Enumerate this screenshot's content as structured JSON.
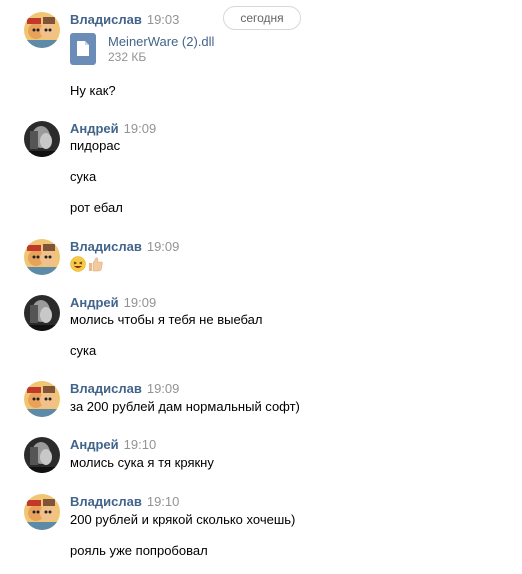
{
  "date_label": "сегодня",
  "messages": [
    {
      "author": "Владислав",
      "time": "19:03",
      "file": {
        "name": "MeinerWare (2).dll",
        "size": "232 КБ",
        "icon": "document-icon"
      },
      "lines": [
        "Ну как?"
      ]
    },
    {
      "author": "Андрей",
      "time": "19:09",
      "lines": [
        "пидорас",
        "сука",
        "рот ебал"
      ]
    },
    {
      "author": "Владислав",
      "time": "19:09",
      "emoji": [
        "laughing-face-emoji",
        "thumbs-up-emoji"
      ]
    },
    {
      "author": "Андрей",
      "time": "19:09",
      "lines": [
        "молись чтобы я тебя не выебал",
        "сука"
      ]
    },
    {
      "author": "Владислав",
      "time": "19:09",
      "lines": [
        "за 200 рублей дам нормальный софт)"
      ]
    },
    {
      "author": "Андрей",
      "time": "19:10",
      "lines": [
        "молись сука я тя крякну"
      ]
    },
    {
      "author": "Владислав",
      "time": "19:10",
      "lines": [
        "200 рублей и крякой сколько хочешь)",
        "рояль уже попробовал"
      ]
    }
  ]
}
